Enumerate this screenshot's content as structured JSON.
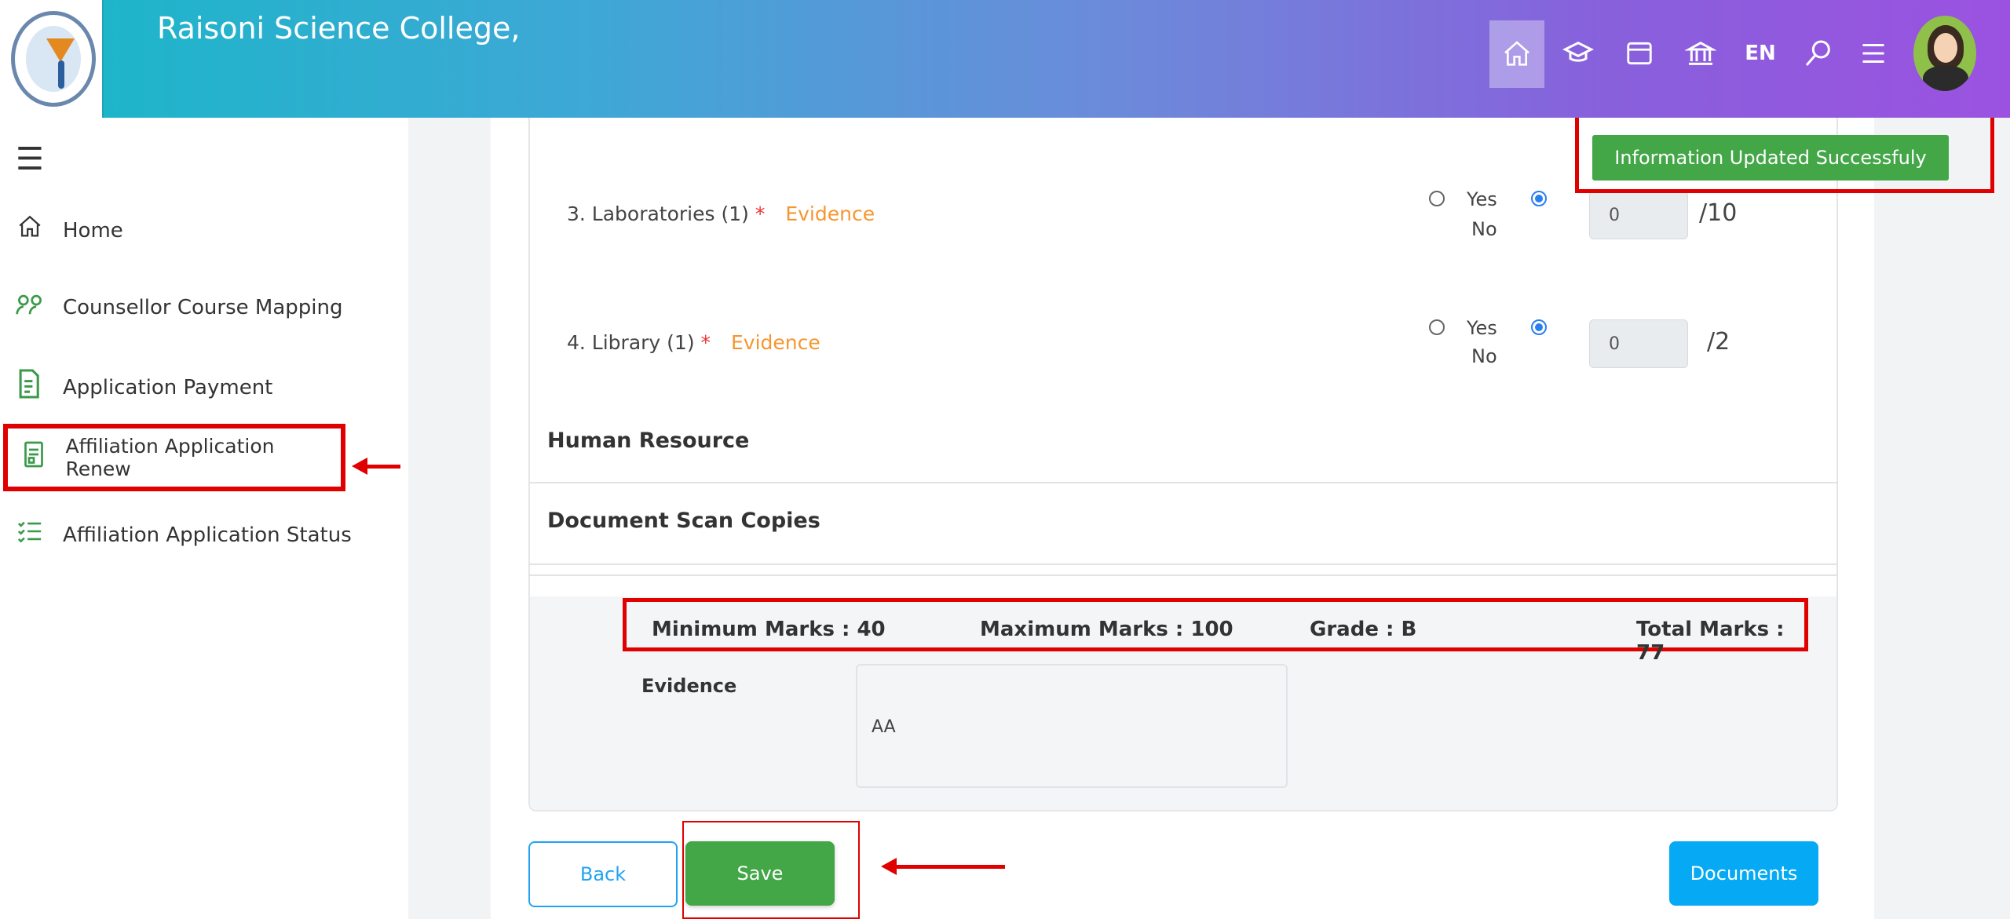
{
  "header": {
    "title": "Raisoni Science College,",
    "lang": "EN",
    "icons": [
      "home-icon",
      "graduation-cap-icon",
      "window-icon",
      "institution-icon",
      "search-icon",
      "menu-icon"
    ]
  },
  "sidebar": {
    "items": [
      {
        "label": "Home",
        "icon": "home-icon"
      },
      {
        "label": "Counsellor Course Mapping",
        "icon": "users-icon"
      },
      {
        "label": "Application Payment",
        "icon": "invoice-icon"
      },
      {
        "label": "Affiliation Application Renew",
        "icon": "document-icon"
      },
      {
        "label": "Affiliation Application Status",
        "icon": "checklist-icon"
      }
    ]
  },
  "questions": [
    {
      "label": "3. Laboratories (1)",
      "required": "*",
      "evidence": "Evidence",
      "yes": "Yes",
      "no": "No",
      "selected": "No",
      "score": "0",
      "max": "/10"
    },
    {
      "label": "4. Library (1)",
      "required": "*",
      "evidence": "Evidence",
      "yes": "Yes",
      "no": "No",
      "selected": "No",
      "score": "0",
      "max": "/2"
    }
  ],
  "sections": {
    "human_resource": "Human Resource",
    "document_scan": "Document Scan Copies"
  },
  "summary": {
    "minimum": "Minimum Marks : 40",
    "maximum": "Maximum Marks : 100",
    "grade": "Grade : B",
    "total": "Total Marks : 77",
    "evidence_label": "Evidence",
    "evidence_value": "AA"
  },
  "toast": {
    "message": "Information Updated Successfuly"
  },
  "buttons": {
    "back": "Back",
    "save": "Save",
    "documents": "Documents"
  },
  "colors": {
    "accent_green": "#43a647",
    "accent_blue": "#06a9f4",
    "highlight_red": "#e00000",
    "evidence_orange": "#f6962f"
  }
}
